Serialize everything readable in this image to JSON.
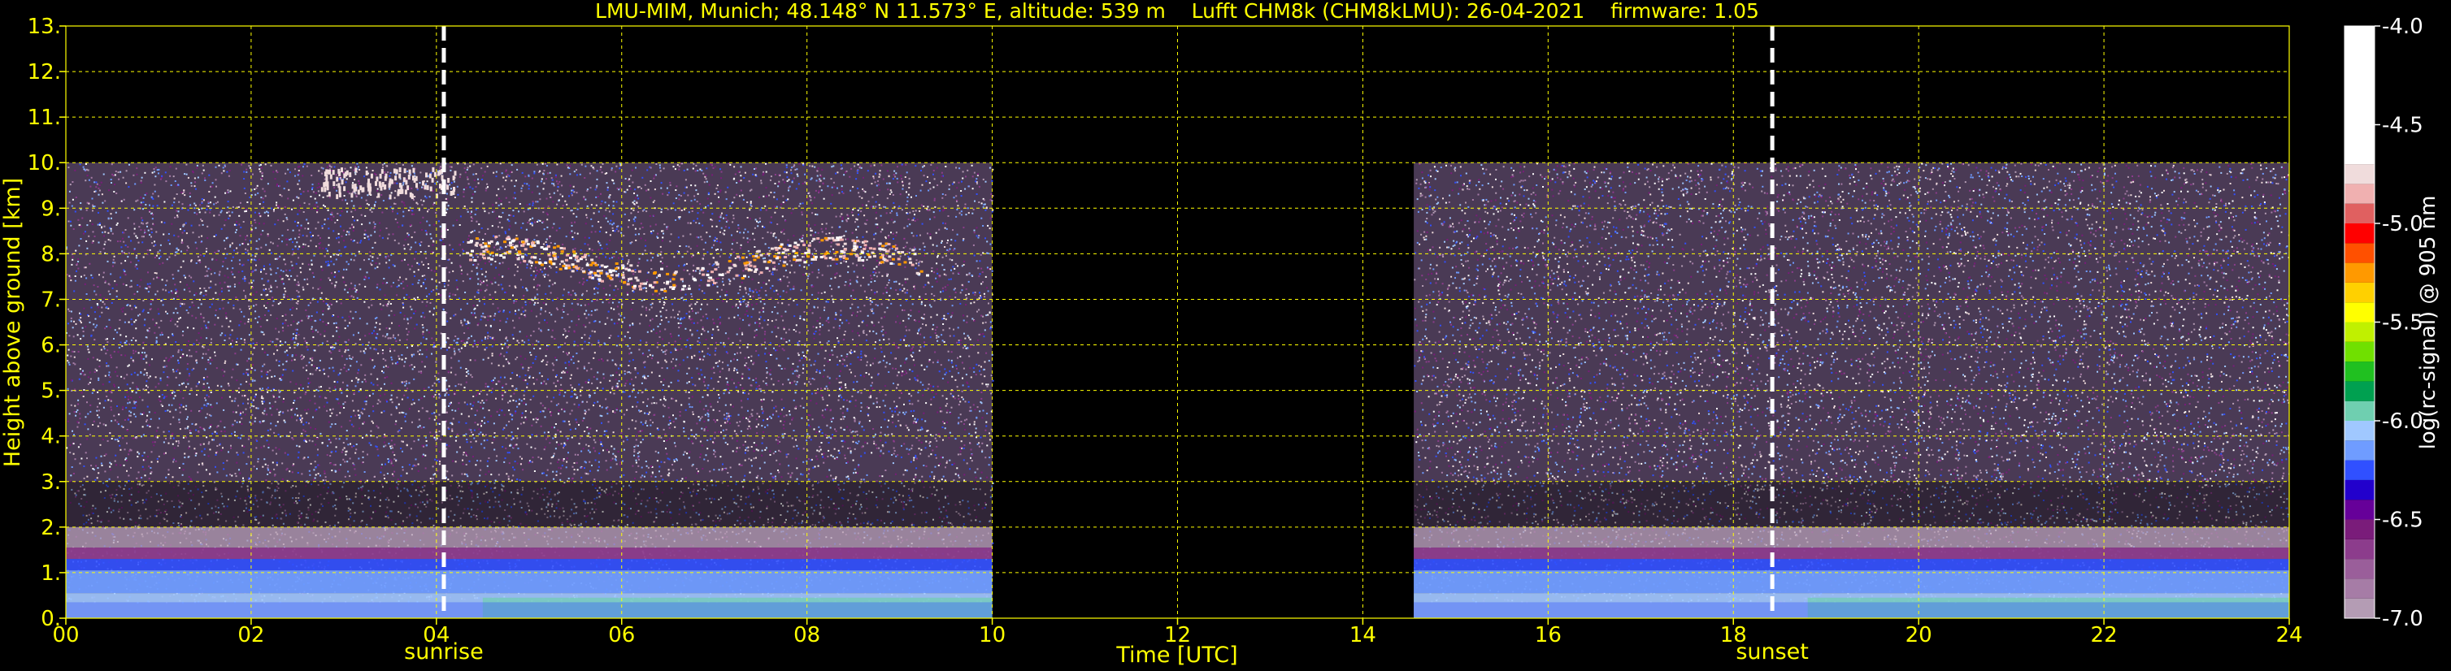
{
  "title": "LMU-MIM, Munich; 48.148° N 11.573° E, altitude: 539 m    Lufft CHM8k (CHM8kLMU): 26-04-2021    firmware: 1.05",
  "colors": {
    "background": "#000000",
    "text": "#ffff00",
    "grid": "#ffff00",
    "marker": "#ffffff",
    "colorbar_label": "#ffffff"
  },
  "chart_data": {
    "type": "heatmap",
    "title": "LMU-MIM, Munich; 48.148° N 11.573° E, altitude: 539 m    Lufft CHM8k (CHM8kLMU): 26-04-2021    firmware: 1.05",
    "xlabel": "Time [UTC]",
    "ylabel": "Height above ground [km]",
    "xlim": [
      0,
      24
    ],
    "ylim": [
      0,
      13
    ],
    "x_ticks": [
      "00",
      "02",
      "04",
      "06",
      "08",
      "10",
      "12",
      "14",
      "16",
      "18",
      "20",
      "22",
      "24"
    ],
    "y_ticks": [
      "0.",
      "1.",
      "2.",
      "3.",
      "4.",
      "5.",
      "6.",
      "7.",
      "8.",
      "9.",
      "10.",
      "11.",
      "12.",
      "13."
    ],
    "grid": true,
    "data_segments": [
      {
        "start": 0.0,
        "end": 10.0,
        "max_height": 10
      },
      {
        "start": 14.55,
        "end": 24.0,
        "max_height": 10
      }
    ],
    "markers": [
      {
        "label": "sunrise",
        "x": 4.08
      },
      {
        "label": "sunset",
        "x": 18.42
      }
    ],
    "colorbar": {
      "label": "log(rc-signal) @ 905 nm",
      "range": [
        -7.0,
        -4.0
      ],
      "ticks": [
        "-4.0",
        "-4.5",
        "-5.0",
        "-5.5",
        "-6.0",
        "-6.5",
        "-7.0"
      ],
      "bands": [
        {
          "from": -7.0,
          "to": -6.9,
          "color": "#b49cb4"
        },
        {
          "from": -6.9,
          "to": -6.8,
          "color": "#a67ca6"
        },
        {
          "from": -6.8,
          "to": -6.7,
          "color": "#9a5e9a"
        },
        {
          "from": -6.7,
          "to": -6.6,
          "color": "#8c3c8c"
        },
        {
          "from": -6.6,
          "to": -6.5,
          "color": "#7a1c7a"
        },
        {
          "from": -6.5,
          "to": -6.4,
          "color": "#660099"
        },
        {
          "from": -6.4,
          "to": -6.3,
          "color": "#2200cc"
        },
        {
          "from": -6.3,
          "to": -6.2,
          "color": "#3050ff"
        },
        {
          "from": -6.2,
          "to": -6.1,
          "color": "#6f9cff"
        },
        {
          "from": -6.1,
          "to": -6.0,
          "color": "#a0c8ff"
        },
        {
          "from": -6.0,
          "to": -5.9,
          "color": "#6fcfb0"
        },
        {
          "from": -5.9,
          "to": -5.8,
          "color": "#00a050"
        },
        {
          "from": -5.8,
          "to": -5.7,
          "color": "#20c020"
        },
        {
          "from": -5.7,
          "to": -5.6,
          "color": "#70e000"
        },
        {
          "from": -5.6,
          "to": -5.5,
          "color": "#c0f000"
        },
        {
          "from": -5.5,
          "to": -5.4,
          "color": "#ffff00"
        },
        {
          "from": -5.4,
          "to": -5.3,
          "color": "#ffd000"
        },
        {
          "from": -5.3,
          "to": -5.2,
          "color": "#ff9900"
        },
        {
          "from": -5.2,
          "to": -5.1,
          "color": "#ff5000"
        },
        {
          "from": -5.1,
          "to": -5.0,
          "color": "#ff0000"
        },
        {
          "from": -5.0,
          "to": -4.9,
          "color": "#e06060"
        },
        {
          "from": -4.9,
          "to": -4.8,
          "color": "#f0b0b0"
        },
        {
          "from": -4.8,
          "to": -4.7,
          "color": "#f0dcdc"
        },
        {
          "from": -4.7,
          "to": -4.0,
          "color": "#ffffff"
        }
      ]
    }
  }
}
